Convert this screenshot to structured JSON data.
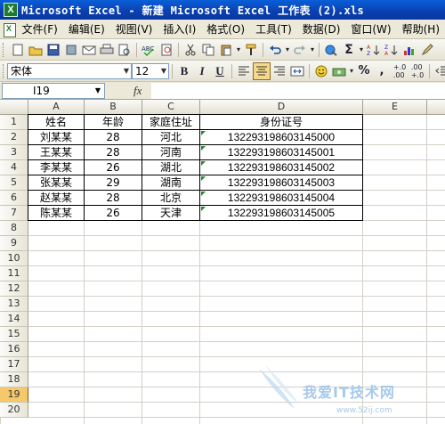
{
  "window": {
    "title": "Microsoft Excel - 新建 Microsoft Excel 工作表 (2).xls"
  },
  "menu": [
    "文件(F)",
    "编辑(E)",
    "视图(V)",
    "插入(I)",
    "格式(O)",
    "工具(T)",
    "数据(D)",
    "窗口(W)",
    "帮助(H)"
  ],
  "format_toolbar": {
    "font_name": "宋体",
    "font_size": "12",
    "bold_label": "B",
    "italic_label": "I",
    "underline_label": "U",
    "sum_label": "Σ"
  },
  "formula_bar": {
    "name_box": "I19",
    "fx_label": "fx",
    "formula": ""
  },
  "columns": [
    "A",
    "B",
    "C",
    "D",
    "E"
  ],
  "rows": [
    "1",
    "2",
    "3",
    "4",
    "5",
    "6",
    "7",
    "8",
    "9",
    "10",
    "11",
    "12",
    "13",
    "14",
    "15",
    "16",
    "17",
    "18",
    "19",
    "20"
  ],
  "selected_row": "19",
  "table": {
    "headers": [
      "姓名",
      "年龄",
      "家庭住址",
      "身份证号"
    ],
    "rows": [
      [
        "刘某某",
        "28",
        "河北",
        "132293198603145000"
      ],
      [
        "王某某",
        "28",
        "河南",
        "132293198603145001"
      ],
      [
        "李某某",
        "26",
        "湖北",
        "132293198603145002"
      ],
      [
        "张某某",
        "29",
        "湖南",
        "132293198603145003"
      ],
      [
        "赵某某",
        "28",
        "北京",
        "132293198603145004"
      ],
      [
        "陈某某",
        "26",
        "天津",
        "132293198603145005"
      ]
    ]
  },
  "watermark": {
    "text": "我爱IT技术网",
    "url": "www.52ij.com"
  },
  "colors": {
    "titlebar": "#0a4fc4",
    "toolbar": "#ece9d8",
    "selected_row": "#f5c96a",
    "error_triangle": "#1f8a2f"
  }
}
